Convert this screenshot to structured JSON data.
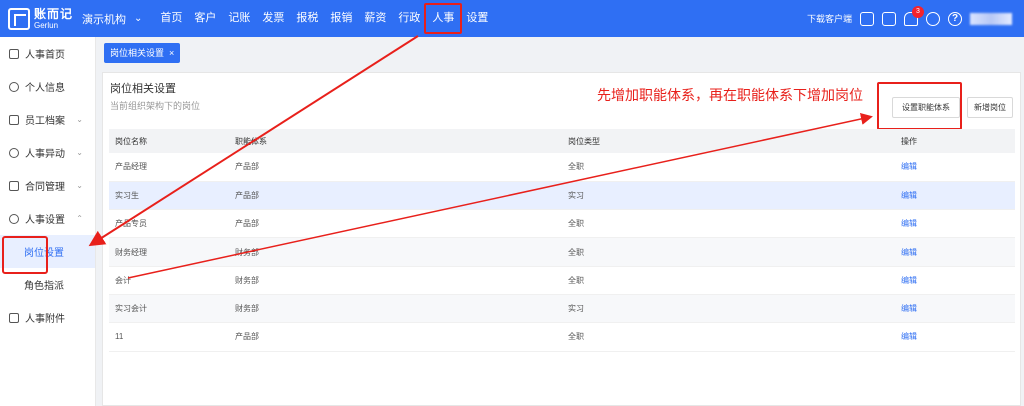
{
  "brand": {
    "name": "账而记",
    "sub": "Gerlun"
  },
  "org": {
    "label": "演示机构"
  },
  "nav": [
    "首页",
    "客户",
    "记账",
    "发票",
    "报税",
    "报销",
    "薪资",
    "行政",
    "人事",
    "设置"
  ],
  "topright": {
    "download": "下载客户端",
    "badge": "3"
  },
  "sidebar": {
    "items": [
      {
        "label": "人事首页"
      },
      {
        "label": "个人信息"
      },
      {
        "label": "员工档案"
      },
      {
        "label": "人事异动"
      },
      {
        "label": "合同管理"
      },
      {
        "label": "人事设置"
      }
    ],
    "sub": [
      {
        "label": "岗位设置"
      },
      {
        "label": "角色指派"
      }
    ],
    "last": {
      "label": "人事附件"
    }
  },
  "tab": {
    "label": "岗位相关设置",
    "close": "×"
  },
  "card": {
    "title": "岗位相关设置",
    "subtitle": "当前组织架构下的岗位",
    "annotation": "先增加职能体系，再在职能体系下增加岗位",
    "btn_system": "设置职能体系",
    "btn_new": "新增岗位"
  },
  "table": {
    "headers": [
      "岗位名称",
      "职能体系",
      "岗位类型",
      "操作"
    ],
    "rows": [
      [
        "产品经理",
        "产品部",
        "全职",
        "编辑"
      ],
      [
        "实习生",
        "产品部",
        "实习",
        "编辑"
      ],
      [
        "产品专员",
        "产品部",
        "全职",
        "编辑"
      ],
      [
        "财务经理",
        "财务部",
        "全职",
        "编辑"
      ],
      [
        "会计",
        "财务部",
        "全职",
        "编辑"
      ],
      [
        "实习会计",
        "财务部",
        "实习",
        "编辑"
      ],
      [
        "11",
        "产品部",
        "全职",
        "编辑"
      ]
    ]
  },
  "colors": {
    "primary": "#2f6ff3",
    "annotation": "#e8201b"
  }
}
